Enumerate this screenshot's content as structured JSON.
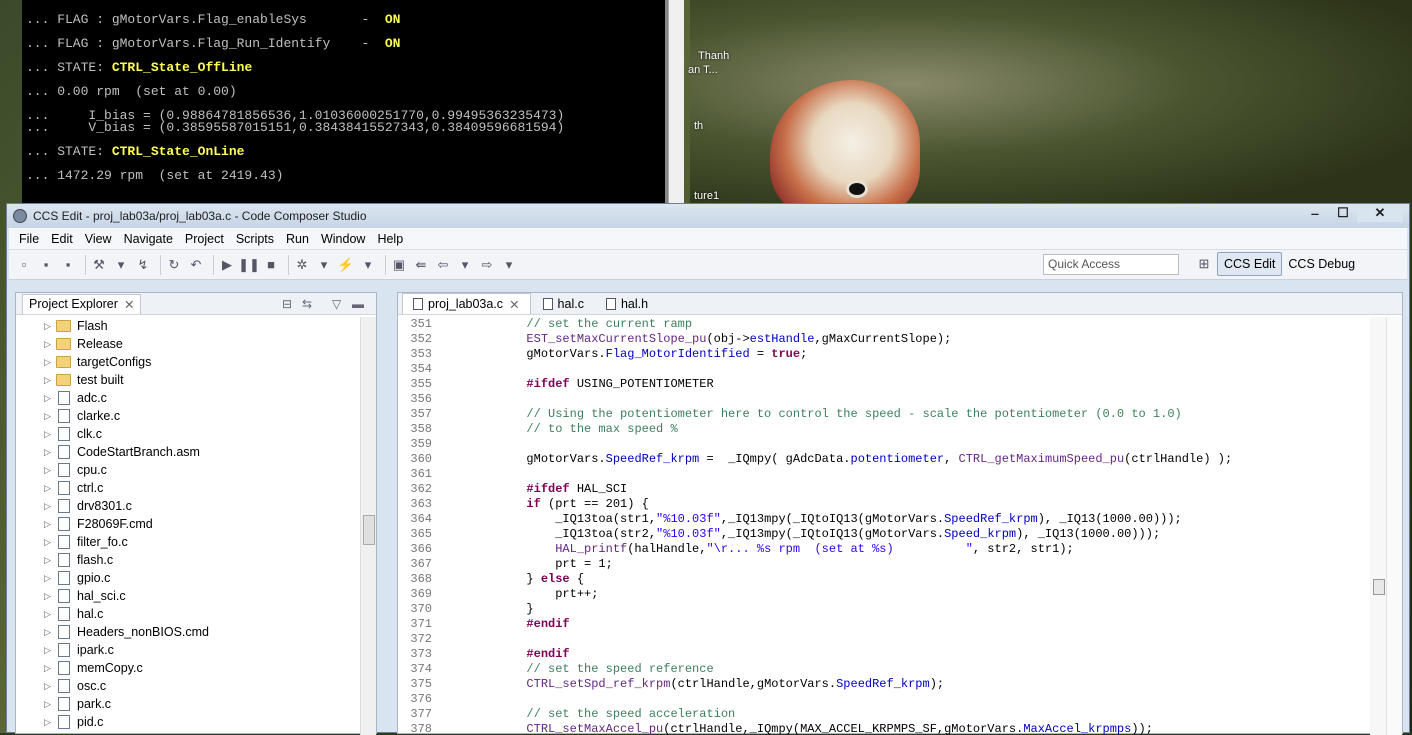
{
  "console": {
    "title": "...",
    "lines": [
      {
        "t": "... FLAG : gMotorVars.Flag_enableSys       -  ",
        "v": "ON"
      },
      {
        "t": "... FLAG : gMotorVars.Flag_Run_Identify    -  ",
        "v": "ON"
      },
      {
        "t": "... STATE: ",
        "v": "CTRL_State_OffLine"
      },
      {
        "t": "... 0.00 rpm  (set at 0.00)",
        "v": ""
      },
      {
        "t": "...     I_bias = (0.98864781856536,1.01036000251770,0.99495363235473)",
        "v": ""
      },
      {
        "t": "...     V_bias = (0.38595587015151,0.38438415527343,0.38409596681594)",
        "v": ""
      },
      {
        "t": "... STATE: ",
        "v": "CTRL_State_OnLine"
      },
      {
        "t": "... 1472.29 rpm  (set at 2419.43)",
        "v": ""
      }
    ]
  },
  "desktop": {
    "labels": [
      "Thanh",
      "an T...",
      "th",
      "ture1"
    ]
  },
  "window": {
    "title": "CCS Edit - proj_lab03a/proj_lab03a.c - Code Composer Studio",
    "btn_min": "‒",
    "btn_max": "☐",
    "btn_close": "✕"
  },
  "menu": [
    "File",
    "Edit",
    "View",
    "Navigate",
    "Project",
    "Scripts",
    "Run",
    "Window",
    "Help"
  ],
  "toolbar": {
    "quick_access": "Quick Access",
    "perspective_edit": "CCS Edit",
    "perspective_debug": "CCS Debug"
  },
  "explorer": {
    "tab_label": "Project Explorer",
    "items": [
      {
        "name": "Flash",
        "type": "folder"
      },
      {
        "name": "Release",
        "type": "folder"
      },
      {
        "name": "targetConfigs",
        "type": "folder"
      },
      {
        "name": "test built",
        "type": "folder"
      },
      {
        "name": "adc.c",
        "type": "file"
      },
      {
        "name": "clarke.c",
        "type": "file"
      },
      {
        "name": "clk.c",
        "type": "file"
      },
      {
        "name": "CodeStartBranch.asm",
        "type": "file"
      },
      {
        "name": "cpu.c",
        "type": "file"
      },
      {
        "name": "ctrl.c",
        "type": "file"
      },
      {
        "name": "drv8301.c",
        "type": "file"
      },
      {
        "name": "F28069F.cmd",
        "type": "file"
      },
      {
        "name": "filter_fo.c",
        "type": "file"
      },
      {
        "name": "flash.c",
        "type": "file"
      },
      {
        "name": "gpio.c",
        "type": "file"
      },
      {
        "name": "hal_sci.c",
        "type": "file"
      },
      {
        "name": "hal.c",
        "type": "file"
      },
      {
        "name": "Headers_nonBIOS.cmd",
        "type": "file"
      },
      {
        "name": "ipark.c",
        "type": "file"
      },
      {
        "name": "memCopy.c",
        "type": "file"
      },
      {
        "name": "osc.c",
        "type": "file"
      },
      {
        "name": "park.c",
        "type": "file"
      },
      {
        "name": "pid.c",
        "type": "file"
      }
    ]
  },
  "editor": {
    "tabs": [
      "proj_lab03a.c",
      "hal.c",
      "hal.h"
    ],
    "lines": [
      {
        "n": "351",
        "h": "            <span class='cm'>// set the current ramp</span>"
      },
      {
        "n": "352",
        "h": "            <span class='fn'>EST_setMaxCurrentSlope_pu</span>(obj-><span class='fld'>estHandle</span>,gMaxCurrentSlope);"
      },
      {
        "n": "353",
        "h": "            gMotorVars.<span class='fld'>Flag_MotorIdentified</span> = <span class='kw'>true</span>;"
      },
      {
        "n": "354",
        "h": ""
      },
      {
        "n": "355",
        "h": "            <span class='pp'>#ifdef</span> USING_POTENTIOMETER"
      },
      {
        "n": "356",
        "h": ""
      },
      {
        "n": "357",
        "h": "            <span class='cm'>// Using the potentiometer here to control the speed - scale the potentiometer (0.0 to 1.0)</span>"
      },
      {
        "n": "358",
        "h": "            <span class='cm'>// to the max speed %</span>"
      },
      {
        "n": "359",
        "h": ""
      },
      {
        "n": "360",
        "h": "            gMotorVars.<span class='fld'>SpeedRef_krpm</span> =  _IQmpy( gAdcData.<span class='fld'>potentiometer</span>, <span class='fn'>CTRL_getMaximumSpeed_pu</span>(ctrlHandle) );"
      },
      {
        "n": "361",
        "h": ""
      },
      {
        "n": "362",
        "h": "            <span class='pp'>#ifdef</span> HAL_SCI"
      },
      {
        "n": "363",
        "h": "            <span class='kw'>if</span> (prt == 201) {"
      },
      {
        "n": "364",
        "h": "                _IQ13toa(str1,<span class='str'>\"%10.03f\"</span>,_IQ13mpy(_IQtoIQ13(gMotorVars.<span class='fld'>SpeedRef_krpm</span>), _IQ13(1000.00)));"
      },
      {
        "n": "365",
        "h": "                _IQ13toa(str2,<span class='str'>\"%10.03f\"</span>,_IQ13mpy(_IQtoIQ13(gMotorVars.<span class='fld'>Speed_krpm</span>), _IQ13(1000.00)));"
      },
      {
        "n": "366",
        "h": "                <span class='fn'>HAL_printf</span>(halHandle,<span class='str'>\"\\r... %s rpm  (set at %s)          \"</span>, str2, str1);"
      },
      {
        "n": "367",
        "h": "                prt = 1;"
      },
      {
        "n": "368",
        "h": "            } <span class='kw'>else</span> {"
      },
      {
        "n": "369",
        "h": "                prt++;"
      },
      {
        "n": "370",
        "h": "            }"
      },
      {
        "n": "371",
        "h": "            <span class='pp'>#endif</span>"
      },
      {
        "n": "372",
        "h": ""
      },
      {
        "n": "373",
        "h": "            <span class='pp'>#endif</span>"
      },
      {
        "n": "374",
        "h": "            <span class='cm'>// set the speed reference</span>"
      },
      {
        "n": "375",
        "h": "            <span class='fn'>CTRL_setSpd_ref_krpm</span>(ctrlHandle,gMotorVars.<span class='fld'>SpeedRef_krpm</span>);"
      },
      {
        "n": "376",
        "h": ""
      },
      {
        "n": "377",
        "h": "            <span class='cm'>// set the speed acceleration</span>"
      },
      {
        "n": "378",
        "h": "            <span class='fn'>CTRL_setMaxAccel_pu</span>(ctrlHandle,_IQmpy(MAX_ACCEL_KRPMPS_SF,gMotorVars.<span class='fld'>MaxAccel_krpmps</span>));"
      }
    ]
  },
  "colors": {
    "console_highlight": "#ffff55",
    "keyword": "#7f0055",
    "comment": "#3f7f5f",
    "string": "#2a00ff",
    "field": "#0000c0"
  }
}
